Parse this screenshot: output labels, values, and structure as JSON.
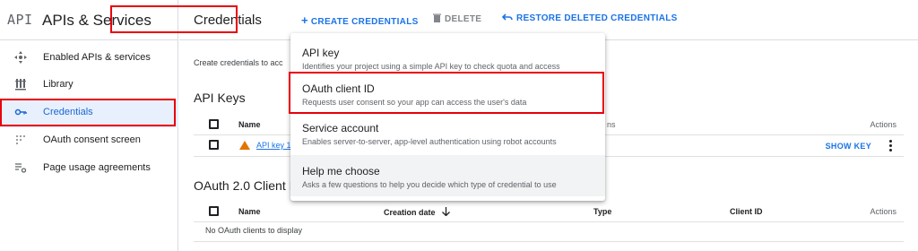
{
  "sidebar": {
    "logo": "API",
    "title": "APIs & Services",
    "items": [
      {
        "label": "Enabled APIs & services",
        "icon": "enabled-apis-icon"
      },
      {
        "label": "Library",
        "icon": "library-icon"
      },
      {
        "label": "Credentials",
        "icon": "key-icon",
        "active": true
      },
      {
        "label": "OAuth consent screen",
        "icon": "consent-icon"
      },
      {
        "label": "Page usage agreements",
        "icon": "settings-list-icon"
      }
    ]
  },
  "toolbar": {
    "title": "Credentials",
    "create_label": "CREATE CREDENTIALS",
    "delete_label": "DELETE",
    "restore_label": "RESTORE DELETED CREDENTIALS"
  },
  "main": {
    "description": "Create credentials to acc",
    "api_keys": {
      "title": "API Keys",
      "columns": {
        "name": "Name",
        "restrictions": "ns",
        "actions": "Actions"
      },
      "rows": [
        {
          "name": "API key 1",
          "action": "SHOW KEY"
        }
      ]
    },
    "oauth": {
      "title": "OAuth 2.0 Client I",
      "columns": {
        "name": "Name",
        "creation_date": "Creation date",
        "type": "Type",
        "client_id": "Client ID",
        "actions": "Actions"
      },
      "empty": "No OAuth clients to display"
    }
  },
  "menu": {
    "items": [
      {
        "title": "API key",
        "desc": "Identifies your project using a simple API key to check quota and access"
      },
      {
        "title": "OAuth client ID",
        "desc": "Requests user consent so your app can access the user's data"
      },
      {
        "title": "Service account",
        "desc": "Enables server-to-server, app-level authentication using robot accounts"
      },
      {
        "title": "Help me choose",
        "desc": "Asks a few questions to help you decide which type of credential to use"
      }
    ]
  },
  "colors": {
    "accent": "#1a73e8",
    "highlight": "#e8000b",
    "warning": "#e37400"
  }
}
